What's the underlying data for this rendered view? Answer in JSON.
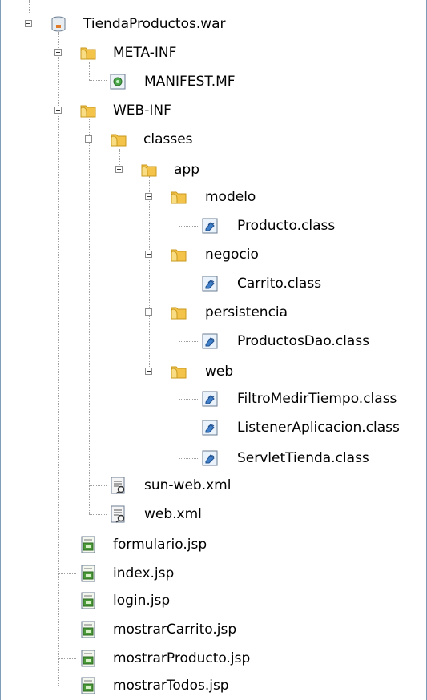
{
  "tree": {
    "root": {
      "label": "TiendaProductos.war",
      "icon": "war-archive-icon"
    },
    "meta_inf": {
      "label": "META-INF",
      "icon": "folder-icon"
    },
    "manifest": {
      "label": "MANIFEST.MF",
      "icon": "manifest-file-icon"
    },
    "web_inf": {
      "label": "WEB-INF",
      "icon": "folder-icon"
    },
    "classes": {
      "label": "classes",
      "icon": "folder-icon"
    },
    "app": {
      "label": "app",
      "icon": "folder-icon"
    },
    "modelo": {
      "label": "modelo",
      "icon": "folder-icon"
    },
    "producto_class": {
      "label": "Producto.class",
      "icon": "class-file-icon"
    },
    "negocio": {
      "label": "negocio",
      "icon": "folder-icon"
    },
    "carrito_class": {
      "label": "Carrito.class",
      "icon": "class-file-icon"
    },
    "persistencia": {
      "label": "persistencia",
      "icon": "folder-icon"
    },
    "productosdao_class": {
      "label": "ProductosDao.class",
      "icon": "class-file-icon"
    },
    "web": {
      "label": "web",
      "icon": "folder-icon"
    },
    "filtro_class": {
      "label": "FiltroMedirTiempo.class",
      "icon": "class-file-icon"
    },
    "listener_class": {
      "label": "ListenerAplicacion.class",
      "icon": "class-file-icon"
    },
    "servlet_class": {
      "label": "ServletTienda.class",
      "icon": "class-file-icon"
    },
    "sun_web_xml": {
      "label": "sun-web.xml",
      "icon": "xml-file-icon"
    },
    "web_xml": {
      "label": "web.xml",
      "icon": "xml-file-icon"
    },
    "formulario_jsp": {
      "label": "formulario.jsp",
      "icon": "jsp-file-icon"
    },
    "index_jsp": {
      "label": "index.jsp",
      "icon": "jsp-file-icon"
    },
    "login_jsp": {
      "label": "login.jsp",
      "icon": "jsp-file-icon"
    },
    "mostrarcarrito_jsp": {
      "label": "mostrarCarrito.jsp",
      "icon": "jsp-file-icon"
    },
    "mostrarproducto_jsp": {
      "label": "mostrarProducto.jsp",
      "icon": "jsp-file-icon"
    },
    "mostrartodos_jsp": {
      "label": "mostrarTodos.jsp",
      "icon": "jsp-file-icon"
    }
  },
  "colors": {
    "folder": "#f3c34a",
    "class_icon": "#3f7fc9",
    "jsp_icon": "#4a9a3a",
    "border": "#7f9db9"
  }
}
